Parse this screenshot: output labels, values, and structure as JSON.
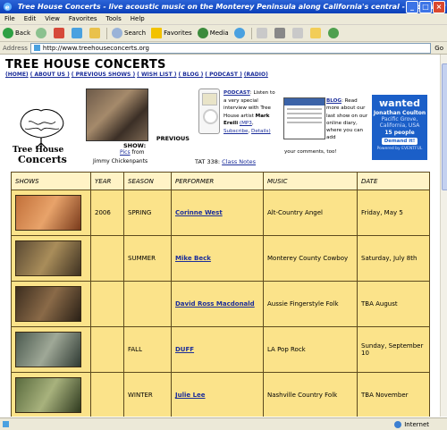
{
  "window": {
    "title": "Tree House Concerts - live acoustic music on the Monterey Peninsula along California's central - Microsoft Internet Explorer"
  },
  "menu": [
    "File",
    "Edit",
    "View",
    "Favorites",
    "Tools",
    "Help"
  ],
  "toolbar": {
    "back": "Back",
    "search": "Search",
    "favorites": "Favorites",
    "media": "Media"
  },
  "address": {
    "label": "Address",
    "url": "http://www.treehouseconcerts.org",
    "go": "Go"
  },
  "site": {
    "title": "TREE HOUSE CONCERTS",
    "nav": [
      "(HOME)",
      "( ABOUT US )",
      "( PREVIOUS SHOWS )",
      "( WISH LIST )",
      "( BLOG )",
      "( PODCAST )",
      "(RADIO)"
    ],
    "previous_label": "PREVIOUS",
    "show_label": "SHOW:",
    "pics_link": "Pics",
    "pics_from": "from",
    "pics_artist": "Jimmy Chickenpants",
    "podcast_link": "PODCAST",
    "podcast_text": "Listen to a very special interview with Tree House artist",
    "podcast_artist": "Mark Ereili",
    "podcast_mp3": "(MP3",
    "podcast_subscribe": "Subscribe",
    "podcast_details": "Details)",
    "tat_label": "TAT 338:",
    "tat_link": "Class Notes",
    "blog_link": "BLOG",
    "blog_text": "Read more about our last show on our online diary, where you can add",
    "blog_tail": "your comments, too!"
  },
  "ad": {
    "headline": "wanted",
    "name": "Jonathan Coulton",
    "place": "Pacific Grove, California, USA",
    "count": "15 people",
    "button": "Demand it!",
    "footer": "Powered by EVENTFUL"
  },
  "table": {
    "headers": [
      "SHOWS",
      "YEAR",
      "SEASON",
      "PERFORMER",
      "MUSIC",
      "DATE"
    ],
    "rows": [
      {
        "year": "2006",
        "season": "SPRING",
        "performer": "Corinne West",
        "music": "Alt-Country Angel",
        "date": "Friday, May 5"
      },
      {
        "year": "",
        "season": "SUMMER",
        "performer": "Mike Beck",
        "music": "Monterey County Cowboy",
        "date": "Saturday, July 8th"
      },
      {
        "year": "",
        "season": "",
        "performer": "David Ross Macdonald",
        "music": "Aussie Fingerstyle Folk",
        "date": "TBA August"
      },
      {
        "year": "",
        "season": "FALL",
        "performer": "DUFF",
        "music": "LA Pop Rock",
        "date": "Sunday, September 10"
      },
      {
        "year": "",
        "season": "WINTER",
        "performer": "Julie Lee",
        "music": "Nashville Country Folk",
        "date": "TBA November"
      }
    ]
  },
  "status": {
    "zone": "Internet"
  }
}
